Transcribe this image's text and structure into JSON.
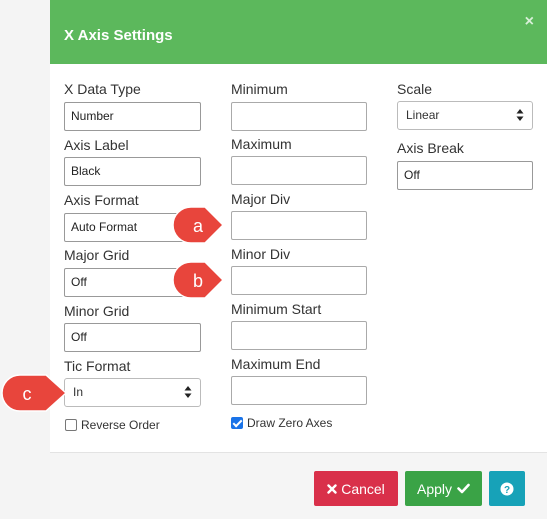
{
  "dialog": {
    "title": "X Axis Settings",
    "close_glyph": "×"
  },
  "col1": {
    "x_data_type": {
      "label": "X Data Type",
      "value": "Number"
    },
    "axis_label": {
      "label": "Axis Label",
      "value": "Black"
    },
    "axis_format": {
      "label": "Axis Format",
      "value": "Auto Format"
    },
    "major_grid": {
      "label": "Major Grid",
      "value": "Off"
    },
    "minor_grid": {
      "label": "Minor Grid",
      "value": "Off"
    },
    "tic_format": {
      "label": "Tic Format",
      "value": "In"
    },
    "reverse_order": {
      "label": "Reverse Order",
      "checked": false
    }
  },
  "col2": {
    "minimum": {
      "label": "Minimum",
      "value": ""
    },
    "maximum": {
      "label": "Maximum",
      "value": ""
    },
    "major_div": {
      "label": "Major Div",
      "value": ""
    },
    "minor_div": {
      "label": "Minor Div",
      "value": ""
    },
    "minimum_start": {
      "label": "Minimum Start",
      "value": ""
    },
    "maximum_end": {
      "label": "Maximum End",
      "value": ""
    },
    "draw_zero_axes": {
      "label": "Draw Zero Axes",
      "checked": true
    }
  },
  "col3": {
    "scale": {
      "label": "Scale",
      "value": "Linear"
    },
    "axis_break": {
      "label": "Axis Break",
      "value": "Off"
    }
  },
  "footer": {
    "cancel_label": "Cancel",
    "apply_label": "Apply",
    "help_glyph": "?"
  },
  "callouts": {
    "a": "a",
    "b": "b",
    "c": "c"
  },
  "colors": {
    "header": "#5cb85c",
    "cancel": "#d9304a",
    "apply": "#3aa346",
    "help": "#17a2b8",
    "callout": "#e8453c"
  },
  "icons": {
    "close": "close-icon",
    "cancel": "times-icon",
    "apply": "check-icon",
    "help": "question-circle-icon",
    "select": "up-down-arrows-icon"
  }
}
